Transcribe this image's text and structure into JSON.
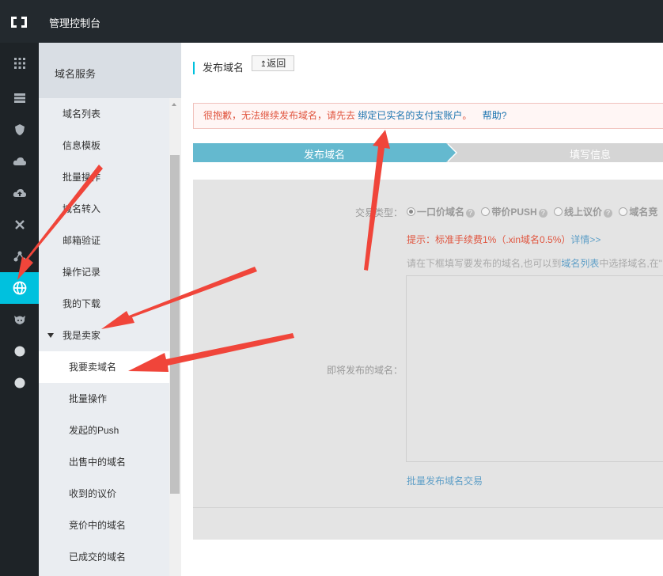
{
  "topbar": {
    "title": "管理控制台"
  },
  "rail": {
    "icons": [
      "apps-grid-icon",
      "server-list-icon",
      "shield-icon",
      "cloud-icon",
      "cloud-upload-icon",
      "cross-icon",
      "nodes-icon",
      "globe-icon",
      "cow-icon",
      "circle-icon",
      "circle-icon"
    ]
  },
  "sidebar": {
    "title": "域名服务",
    "items": [
      {
        "label": "域名列表"
      },
      {
        "label": "信息模板"
      },
      {
        "label": "批量操作"
      },
      {
        "label": "域名转入"
      },
      {
        "label": "邮箱验证"
      },
      {
        "label": "操作记录"
      },
      {
        "label": "我的下载"
      }
    ],
    "group": {
      "label": "我是卖家"
    },
    "subitems": [
      {
        "label": "我要卖域名",
        "active": true
      },
      {
        "label": "批量操作"
      },
      {
        "label": "发起的Push"
      },
      {
        "label": "出售中的域名"
      },
      {
        "label": "收到的议价"
      },
      {
        "label": "竞价中的域名"
      },
      {
        "label": "已成交的域名"
      }
    ]
  },
  "main": {
    "title": "发布域名",
    "back_label": "返回",
    "alert": {
      "text": "很抱歉，无法继续发布域名，请先去",
      "link": "绑定已实名的支付宝账户",
      "suffix": "。",
      "help": "帮助?"
    },
    "steps": [
      "发布域名",
      "填写信息"
    ],
    "form": {
      "type_label": "交易类型：",
      "options": [
        "一口价域名",
        "带价PUSH",
        "线上议价",
        "域名竞"
      ],
      "fee_hint": "提示：标准手续费1%（.xin域名0.5%）",
      "fee_more": "详情>>",
      "input_hint_pre": "请在下框填写要发布的域名,也可以到",
      "input_hint_link": "域名列表",
      "input_hint_post": "中选择域名,在\"",
      "domains_label": "即将发布的域名：",
      "domains_value": "",
      "batch_link": "批量发布域名交易"
    }
  },
  "colors": {
    "topbar": "#23292e",
    "rail": "#1e2327",
    "accent": "#00c1de",
    "step_active": "#64b9cf",
    "alert_text": "#e0553f",
    "link": "#1c74b0",
    "arrow": "#f0453a"
  }
}
